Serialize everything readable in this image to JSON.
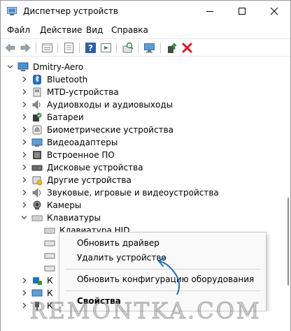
{
  "window": {
    "title": "Диспетчер устройств",
    "controls": [
      "minimize",
      "maximize",
      "close"
    ]
  },
  "menu": [
    "Файл",
    "Действие",
    "Вид",
    "Справка"
  ],
  "toolbar": [
    "back-arrow-icon",
    "forward-arrow-icon",
    "properties-icon",
    "device-list-icon",
    "help-icon",
    "run-icon",
    "scan-hardware-icon",
    "monitor-icon",
    "update-driver-icon",
    "uninstall-x-icon"
  ],
  "tree": {
    "root": "Dmitry-Aero",
    "categories": [
      {
        "label": "Bluetooth",
        "icon": "bluetooth-icon"
      },
      {
        "label": "MTD-устройства",
        "icon": "mtd-icon"
      },
      {
        "label": "Аудиовходы и аудиовыходы",
        "icon": "speaker-icon"
      },
      {
        "label": "Батареи",
        "icon": "battery-icon"
      },
      {
        "label": "Биометрические устройства",
        "icon": "fingerprint-icon"
      },
      {
        "label": "Видеоадаптеры",
        "icon": "display-adapter-icon"
      },
      {
        "label": "Встроенное ПО",
        "icon": "firmware-icon"
      },
      {
        "label": "Дисковые устройства",
        "icon": "disk-icon"
      },
      {
        "label": "Другие устройства",
        "icon": "unknown-device-icon"
      },
      {
        "label": "Звуковые, игровые и видеоустройства",
        "icon": "sound-icon"
      },
      {
        "label": "Камеры",
        "icon": "camera-icon"
      },
      {
        "label": "Клавиатуры",
        "icon": "keyboard-icon",
        "expanded": true
      }
    ],
    "keyboard_children": [
      "Клавиатура HID"
    ],
    "partial_rows": [
      "К",
      "К",
      "К"
    ]
  },
  "context_menu": {
    "items": [
      "Обновить драйвер",
      "Удалить устройство",
      "Обновить конфигурацию оборудования",
      "Свойства"
    ],
    "highlighted": "Удалить устройство"
  },
  "annotation": {
    "color": "#1e6fc0"
  },
  "watermark": "REMONTKA.COM",
  "colors": {
    "accent_blue": "#1e6fc0",
    "uninstall_red": "#e81123",
    "text": "#000000"
  }
}
